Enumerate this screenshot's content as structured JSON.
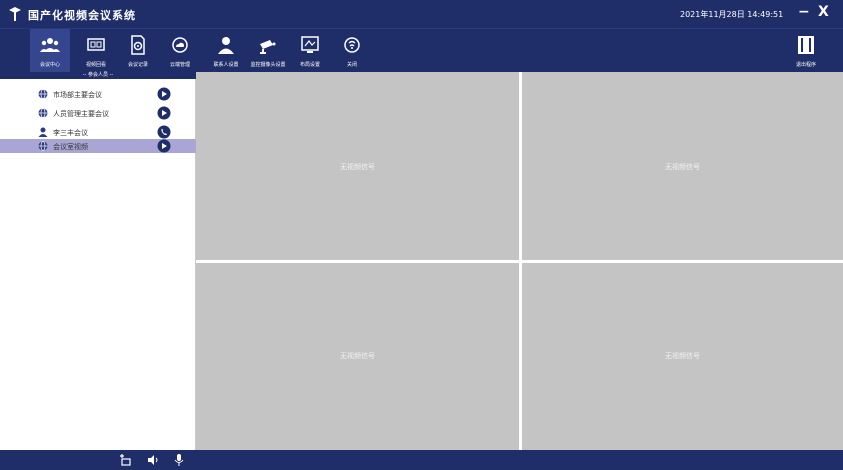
{
  "app": {
    "title": "国产化视频会议系统",
    "datetime": "2021年11月28日 14:49:51",
    "minimize_label": "−",
    "close_label": "X"
  },
  "toolbar": {
    "items": [
      {
        "label": "会议中心",
        "icon": "group-icon",
        "active": true
      },
      {
        "label": "视频回看",
        "icon": "screen-icon",
        "active": false
      },
      {
        "label": "会议记录",
        "icon": "document-gear-icon",
        "active": false
      },
      {
        "label": "云端管理",
        "icon": "cloud-icon",
        "active": false
      },
      {
        "label": "联系人设置",
        "icon": "user-icon",
        "active": false
      },
      {
        "label": "监控摄像头设置",
        "icon": "camera-icon",
        "active": false
      },
      {
        "label": "布局设置",
        "icon": "layout-monitor-icon",
        "active": false
      },
      {
        "label": "关闭",
        "icon": "power-icon",
        "active": false
      }
    ],
    "right_button_label": "退出程序"
  },
  "sidebar": {
    "header": "-- 参会人员 --",
    "items": [
      {
        "label": "市场部主要会议",
        "icon": "globe-icon",
        "action": "play-icon",
        "selected": false
      },
      {
        "label": "人员管理主要会议",
        "icon": "globe-icon",
        "action": "play-icon",
        "selected": false
      },
      {
        "label": "李三丰会议",
        "icon": "person-icon",
        "action": "phone-icon",
        "selected": false
      },
      {
        "label": "会议室视频",
        "icon": "globe-icon",
        "action": "play-icon",
        "selected": true
      }
    ]
  },
  "video_tiles": [
    {
      "label": "无视频信号"
    },
    {
      "label": "无视频信号"
    },
    {
      "label": "无视频信号"
    },
    {
      "label": "无视频信号"
    }
  ],
  "bottombar": {
    "icons": [
      "screen-share-icon",
      "speaker-icon",
      "microphone-icon"
    ]
  },
  "colors": {
    "primary": "#1f2d68",
    "selected_row": "#a9a6d6",
    "tile": "#c4c4c4"
  }
}
